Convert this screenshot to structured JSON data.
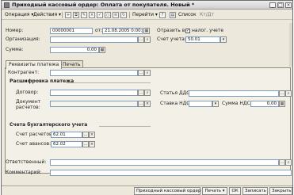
{
  "window": {
    "title": "Приходный кассовый ордер: Оплата от покупателя. Новый *"
  },
  "toolbar": {
    "operation_label": "Операция",
    "actions_label": "Действия",
    "goto_label": "Перейти",
    "help_label": "?",
    "list_label": "Список",
    "kt_label": "Кт/Дт"
  },
  "header": {
    "number_label": "Номер:",
    "number_value": "00000001",
    "date_label": "от:",
    "date_value": "21.08.2005 0:00:00",
    "reflect_label": "Отразить в:",
    "tax_accounting_label": "налог. учете",
    "tax_accounting_checked": true,
    "org_label": "Организация:",
    "org_value": "",
    "account_label": "Счет учета:",
    "account_value": "50.01",
    "sum_label": "Сумма:",
    "sum_value": "0,00"
  },
  "tabs": [
    {
      "label": "Реквизиты платежа",
      "active": true
    },
    {
      "label": "Печать",
      "active": false
    }
  ],
  "payment": {
    "counterparty_label": "Контрагент:",
    "counterparty_value": "",
    "section_title": "Расшифровка платежа",
    "contract_label": "Договор:",
    "contract_value": "",
    "doc_label_line1": "Документ",
    "doc_label_line2": "расчетов:",
    "doc_value": "",
    "dds_label": "Статья ДДС:",
    "dds_value": "",
    "vat_rate_label": "Ставка НДС:",
    "vat_rate_value": "",
    "vat_sum_label": "Сумма НДС:",
    "vat_sum_value": "0,00"
  },
  "accounts": {
    "section_title": "Счета бухгалтерского учета",
    "settlement_label": "Счет расчетов:",
    "settlement_value": "62.01",
    "advance_label": "Счет авансов:",
    "advance_value": "62.02"
  },
  "footer_fields": {
    "responsible_label": "Ответственный:",
    "responsible_value": "",
    "comment_label": "Комментарий:",
    "comment_value": ""
  },
  "statusbar": {
    "print_form_label": "Приходный кассовый ордер",
    "print_label": "Печать",
    "ok_label": "ОК",
    "save_label": "Записать",
    "close_label": "Закрыть"
  }
}
